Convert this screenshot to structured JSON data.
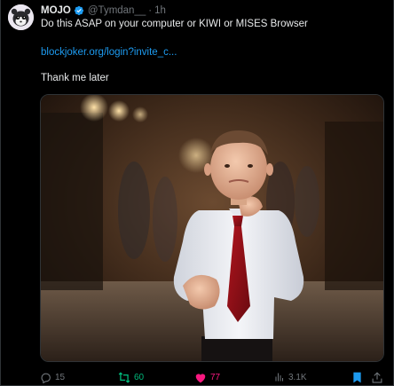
{
  "tweet": {
    "author_name": "MOJO",
    "author_handle": "@Tymdan__",
    "separator": "·",
    "timestamp": "1h",
    "line1": "Do this ASAP on your computer or KIWI or MISES Browser",
    "link": "blockjoker.org/login?invite_c...",
    "line3": "Thank me later"
  },
  "actions": {
    "replies": "15",
    "reposts": "60",
    "likes": "77",
    "views": "3.1K"
  },
  "icons": {
    "verified": "verified-badge-icon",
    "reply": "reply-icon",
    "repost": "repost-icon",
    "like": "heart-icon",
    "views": "views-icon",
    "bookmark": "bookmark-icon",
    "share": "share-icon"
  },
  "colors": {
    "background": "#000000",
    "text": "#e7e9ea",
    "muted": "#71767b",
    "link": "#1d9bf0",
    "repost_active": "#00ba7c",
    "like_active": "#f91880",
    "bookmark_active": "#1d9bf0"
  }
}
